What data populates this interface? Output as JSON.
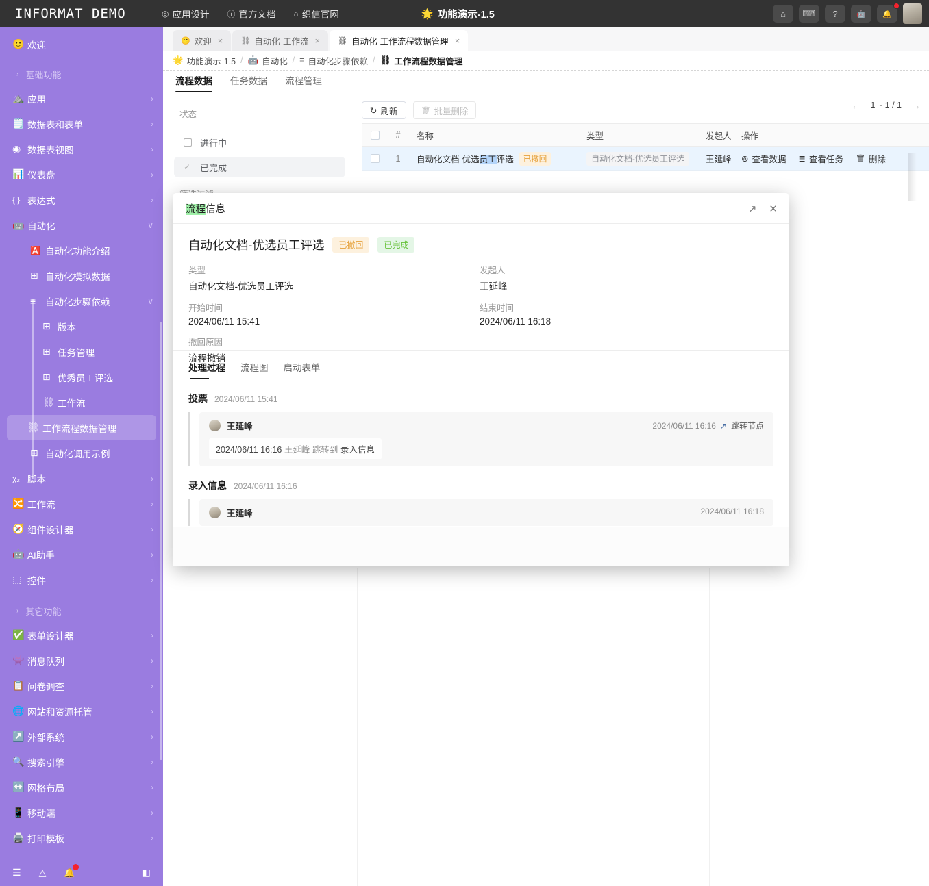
{
  "topbar": {
    "brand": "INFORMAT DEMO",
    "nav": [
      {
        "icon": "target-icon",
        "glyph": "◎",
        "label": "应用设计"
      },
      {
        "icon": "info-icon",
        "glyph": "ⓘ",
        "label": "官方文档"
      },
      {
        "icon": "home-icon",
        "glyph": "⌂",
        "label": "织信官网"
      }
    ],
    "app_title": "功能演示-1.5",
    "app_title_emoji": "🌟",
    "right_buttons": [
      {
        "name": "home-icon",
        "glyph": "⌂"
      },
      {
        "name": "feedback-icon",
        "glyph": "⌨"
      },
      {
        "name": "help-icon",
        "glyph": "?"
      },
      {
        "name": "robot-icon",
        "glyph": "🤖"
      },
      {
        "name": "bell-icon",
        "glyph": "🔔",
        "badge": true
      }
    ]
  },
  "sidebar": {
    "welcome": {
      "emoji": "🙂",
      "label": "欢迎"
    },
    "group1": "基础功能",
    "items1": [
      {
        "emoji": "⛰️",
        "label": "应用",
        "arrow": "›"
      },
      {
        "emoji": "🗒️",
        "label": "数据表和表单",
        "arrow": "›"
      },
      {
        "emoji": "◉",
        "label": "数据表视图",
        "arrow": "›"
      },
      {
        "emoji": "📊",
        "label": "仪表盘",
        "arrow": "›"
      },
      {
        "emoji": "{ }",
        "label": "表达式",
        "arrow": "›"
      }
    ],
    "automation": {
      "emoji": "🤖",
      "label": "自动化",
      "arrow": "∨"
    },
    "automation_children": [
      {
        "emoji": "🅰️",
        "label": "自动化功能介绍",
        "level": 1
      },
      {
        "emoji": "⊞",
        "label": "自动化模拟数据",
        "level": 1
      },
      {
        "emoji": "≡",
        "label": "自动化步骤依赖",
        "level": 1,
        "arrow": "∨"
      },
      {
        "emoji": "⊞",
        "label": "版本",
        "level": 2
      },
      {
        "emoji": "⊞",
        "label": "任务管理",
        "level": 2
      },
      {
        "emoji": "⊞",
        "label": "优秀员工评选",
        "level": 2
      },
      {
        "emoji": "⛓",
        "label": "工作流",
        "level": 2
      },
      {
        "emoji": "⛓",
        "label": "工作流程数据管理",
        "level": 2,
        "active": true
      },
      {
        "emoji": "⊞",
        "label": "自动化调用示例",
        "level": 1
      }
    ],
    "items2": [
      {
        "emoji": "χ₂",
        "label": "脚本",
        "arrow": "›"
      },
      {
        "emoji": "🔀",
        "label": "工作流",
        "arrow": "›"
      },
      {
        "emoji": "🧭",
        "label": "组件设计器",
        "arrow": "›"
      },
      {
        "emoji": "🤖",
        "label": "AI助手",
        "arrow": "›"
      },
      {
        "emoji": "⬚",
        "label": "控件",
        "arrow": "›"
      }
    ],
    "group2": "其它功能",
    "items3": [
      {
        "emoji": "✅",
        "label": "表单设计器",
        "arrow": "›"
      },
      {
        "emoji": "👾",
        "label": "消息队列",
        "arrow": "›"
      },
      {
        "emoji": "📋",
        "label": "问卷调查",
        "arrow": "›"
      },
      {
        "emoji": "🌐",
        "label": "网站和资源托管",
        "arrow": "›"
      },
      {
        "emoji": "↗️",
        "label": "外部系统",
        "arrow": "›"
      },
      {
        "emoji": "🔍",
        "label": "搜索引擎",
        "arrow": "›"
      },
      {
        "emoji": "↔️",
        "label": "网格布局",
        "arrow": "›"
      },
      {
        "emoji": "📱",
        "label": "移动端",
        "arrow": "›"
      },
      {
        "emoji": "🖨️",
        "label": "打印模板",
        "arrow": "›"
      }
    ],
    "footer": [
      {
        "name": "menu-icon",
        "glyph": "☰"
      },
      {
        "name": "upload-icon",
        "glyph": "△"
      },
      {
        "name": "bell-icon",
        "glyph": "🔔",
        "badge": true
      },
      {
        "name": "panel-toggle-icon",
        "glyph": "◧"
      }
    ]
  },
  "tabs": [
    {
      "icon": "smile-icon",
      "glyph": "🙂",
      "label": "欢迎",
      "active": false
    },
    {
      "icon": "workflow-icon",
      "glyph": "⛓",
      "label": "自动化-工作流",
      "active": false
    },
    {
      "icon": "workflow-icon",
      "glyph": "⛓",
      "label": "自动化-工作流程数据管理",
      "active": true
    }
  ],
  "breadcrumb": [
    {
      "glyph": "🌟",
      "label": "功能演示-1.5"
    },
    {
      "glyph": "🤖",
      "label": "自动化"
    },
    {
      "glyph": "≡",
      "label": "自动化步骤依赖"
    },
    {
      "glyph": "⛓",
      "label": "工作流程数据管理"
    }
  ],
  "subtabs": [
    {
      "label": "流程数据",
      "active": true
    },
    {
      "label": "任务数据",
      "active": false
    },
    {
      "label": "流程管理",
      "active": false
    }
  ],
  "filter_panel": {
    "status_title": "状态",
    "options": [
      {
        "label": "进行中",
        "selected": false,
        "icon": "checkbox-icon"
      },
      {
        "label": "已完成",
        "selected": true,
        "icon": "check-icon"
      }
    ],
    "filter_title": "筛选过滤"
  },
  "toolbar": {
    "refresh_label": "刷新",
    "refresh_icon": "↻",
    "batch_delete_label": "批量删除",
    "batch_delete_icon": "🗑",
    "pager_text": "1 ~ 1 / 1",
    "prev_glyph": "←",
    "next_glyph": "→"
  },
  "table": {
    "headers": [
      "#",
      "名称",
      "类型",
      "发起人",
      "操作"
    ],
    "rows": [
      {
        "num": "1",
        "name_pre": "自动化文档-优选",
        "name_sel": "员工",
        "name_post": "评选",
        "badge": "已撤回",
        "type": "自动化文档-优选员工评选",
        "originator": "王延峰",
        "ops": [
          {
            "icon": "database-icon",
            "glyph": "⊚",
            "label": "查看数据"
          },
          {
            "icon": "list-icon",
            "glyph": "≣",
            "label": "查看任务"
          },
          {
            "icon": "trash-icon",
            "glyph": "🗑",
            "label": "删除"
          }
        ]
      }
    ]
  },
  "modal": {
    "title_hl": "流程",
    "title_rest": "信息",
    "expand_icon": "↗",
    "close_icon": "✕",
    "heading": "自动化文档-优选员工评选",
    "tag_withdrawn": "已撤回",
    "tag_done": "已完成",
    "fields": {
      "type_label": "类型",
      "type_value": "自动化文档-优选员工评选",
      "start_label": "开始时间",
      "start_value": "2024/06/11 15:41",
      "reason_label": "撤回原因",
      "reason_value": "流程撤销",
      "initiator_label": "发起人",
      "initiator_value": "王延峰",
      "end_label": "结束时间",
      "end_value": "2024/06/11 16:18"
    },
    "tabs": [
      {
        "label": "处理过程",
        "active": true
      },
      {
        "label": "流程图",
        "active": false
      },
      {
        "label": "启动表单",
        "active": false
      }
    ],
    "nodes": [
      {
        "name": "投票",
        "time": "2024/06/11 15:41",
        "user": "王延峰",
        "right_time": "2024/06/11 16:16",
        "right_arrow": "↗",
        "right_action": "跳转节点",
        "sub_time": "2024/06/11 16:16",
        "sub_user": "王延峰",
        "sub_action": "跳转到",
        "sub_target": "录入信息"
      },
      {
        "name": "录入信息",
        "time": "2024/06/11 16:16",
        "user": "王延峰",
        "right_time": "2024/06/11 16:18",
        "right_arrow": "",
        "right_action": "",
        "sub_time": "",
        "sub_user": "",
        "sub_action": "",
        "sub_target": ""
      }
    ]
  }
}
